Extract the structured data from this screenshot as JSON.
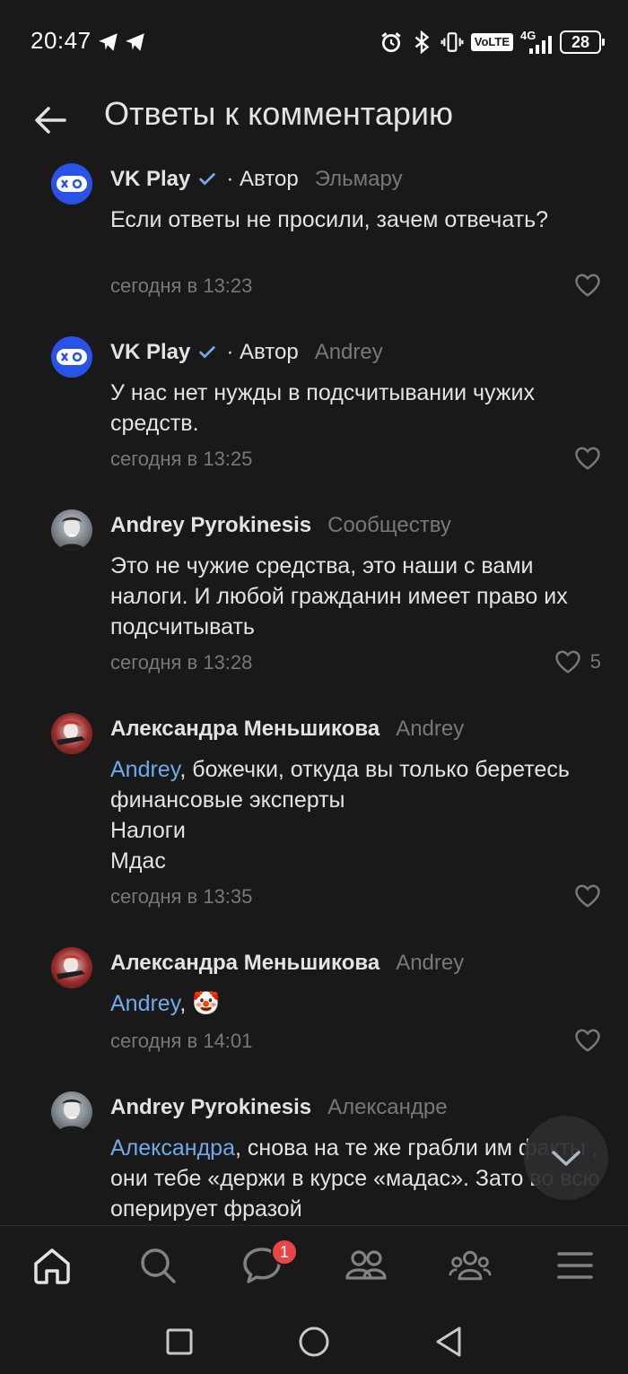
{
  "status_bar": {
    "time": "20:47",
    "network": "VoLTE",
    "signal_type": "4G",
    "battery": "28"
  },
  "header": {
    "title": "Ответы к комментарию"
  },
  "comments": [
    {
      "author": "VK Play",
      "verified": true,
      "role": "· Автор",
      "reply_to": "Эльмару",
      "text": "Если ответы не просили, зачем отвечать?",
      "time": "сегодня в 13:23",
      "likes": ""
    },
    {
      "author": "VK Play",
      "verified": true,
      "role": "· Автор",
      "reply_to": "Andrey",
      "text": "У нас нет нужды в подсчитывании чужих средств.",
      "time": "сегодня в 13:25",
      "likes": ""
    },
    {
      "author": "Andrey Pyrokinesis",
      "verified": false,
      "role": "",
      "reply_to": "Сообществу",
      "text": "Это не чужие средства, это наши с вами налоги. И любой гражданин имеет право их подсчитывать",
      "time": "сегодня в 13:28",
      "likes": "5"
    },
    {
      "author": "Александра Меньшикова",
      "verified": false,
      "role": "",
      "reply_to": "Andrey",
      "mention": "Andrey",
      "text": ", божечки, откуда вы только беретесь финансовые эксперты",
      "text_line2": "Налоги",
      "text_line3": "Мдас",
      "time": "сегодня в 13:35",
      "likes": ""
    },
    {
      "author": "Александра Меньшикова",
      "verified": false,
      "role": "",
      "reply_to": "Andrey",
      "mention": "Andrey",
      "text": ", 🤡",
      "time": "сегодня в 14:01",
      "likes": ""
    },
    {
      "author": "Andrey Pyrokinesis",
      "verified": false,
      "role": "",
      "reply_to": "Александре",
      "mention": "Александра",
      "text": ", снова на те же грабли им факты , они тебе «держи в курсе «мадас». Зато во всю оперирует фразой",
      "time": "",
      "likes": ""
    }
  ],
  "colors": {
    "background": "#19191a",
    "accent": "#71aaeb",
    "muted": "#76787a",
    "badge": "#e64646"
  },
  "tabbar": {
    "items": [
      "home-icon",
      "search-icon",
      "messages-icon",
      "friends-icon",
      "communities-icon",
      "menu-icon"
    ],
    "messages_badge": "1"
  },
  "android_nav": [
    "recents-icon",
    "home-circle-icon",
    "back-triangle-icon"
  ]
}
